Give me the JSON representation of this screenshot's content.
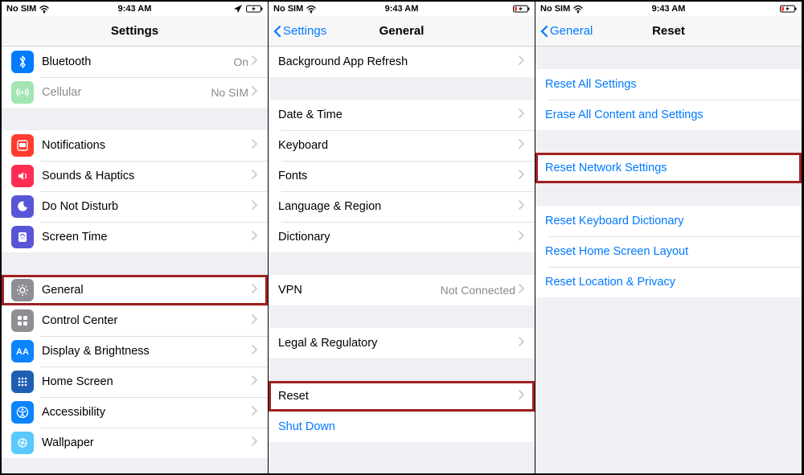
{
  "status": {
    "carrier": "No SIM",
    "time": "9:43 AM"
  },
  "pane1": {
    "title": "Settings",
    "rows": {
      "bluetooth": {
        "label": "Bluetooth",
        "value": "On"
      },
      "cellular": {
        "label": "Cellular",
        "value": "No SIM"
      },
      "notifications": {
        "label": "Notifications"
      },
      "sounds": {
        "label": "Sounds & Haptics"
      },
      "dnd": {
        "label": "Do Not Disturb"
      },
      "screentime": {
        "label": "Screen Time"
      },
      "general": {
        "label": "General"
      },
      "controlcenter": {
        "label": "Control Center"
      },
      "display": {
        "label": "Display & Brightness"
      },
      "homescreen": {
        "label": "Home Screen"
      },
      "accessibility": {
        "label": "Accessibility"
      },
      "wallpaper": {
        "label": "Wallpaper"
      }
    }
  },
  "pane2": {
    "back": "Settings",
    "title": "General",
    "rows": {
      "bgapp": {
        "label": "Background App Refresh"
      },
      "datetime": {
        "label": "Date & Time"
      },
      "keyboard": {
        "label": "Keyboard"
      },
      "fonts": {
        "label": "Fonts"
      },
      "langregion": {
        "label": "Language & Region"
      },
      "dictionary": {
        "label": "Dictionary"
      },
      "vpn": {
        "label": "VPN",
        "value": "Not Connected"
      },
      "legal": {
        "label": "Legal & Regulatory"
      },
      "reset": {
        "label": "Reset"
      },
      "shutdown": {
        "label": "Shut Down"
      }
    }
  },
  "pane3": {
    "back": "General",
    "title": "Reset",
    "rows": {
      "resetall": {
        "label": "Reset All Settings"
      },
      "eraseall": {
        "label": "Erase All Content and Settings"
      },
      "resetnet": {
        "label": "Reset Network Settings"
      },
      "resetkbd": {
        "label": "Reset Keyboard Dictionary"
      },
      "resethome": {
        "label": "Reset Home Screen Layout"
      },
      "resetloc": {
        "label": "Reset Location & Privacy"
      }
    }
  }
}
